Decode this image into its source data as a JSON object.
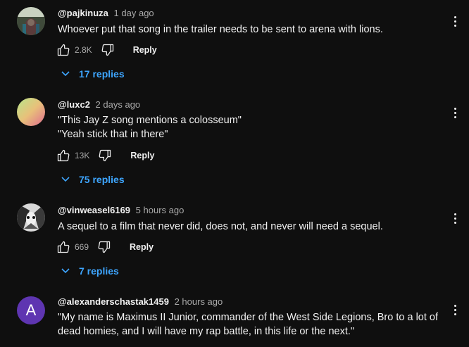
{
  "comments": [
    {
      "author": "@pajkinuza",
      "time": "1 day ago",
      "lines": [
        "Whoever put that song in the trailer needs to be sent to arena with lions."
      ],
      "likes": "2.8K",
      "reply_label": "Reply",
      "replies_label": "17 replies",
      "avatar_icon": "photo-avatar-icon"
    },
    {
      "author": "@luxc2",
      "time": "2 days ago",
      "lines": [
        "\"This Jay Z song mentions a colosseum\"",
        "\"Yeah stick that in there\""
      ],
      "likes": "13K",
      "reply_label": "Reply",
      "replies_label": "75 replies",
      "avatar_icon": "gradient-avatar-icon"
    },
    {
      "author": "@vinweasel6169",
      "time": "5 hours ago",
      "lines": [
        "A sequel to a film that never did, does not, and never will need a sequel."
      ],
      "likes": "669",
      "reply_label": "Reply",
      "replies_label": "7 replies",
      "avatar_icon": "animal-avatar-icon"
    },
    {
      "author": "@alexanderschastak1459",
      "time": "2 hours ago",
      "lines": [
        "\"My name is Maximus II Junior, commander of the West Side Legions, Bro to a lot of",
        "dead homies, and I will have my rap battle, in this life or the next.\""
      ],
      "avatar_letter": "A"
    }
  ],
  "colors": {
    "background": "#0f0f0f",
    "link": "#3ea6ff",
    "secondary_text": "#aaaaaa",
    "letter_avatar": "#5e35b1"
  }
}
